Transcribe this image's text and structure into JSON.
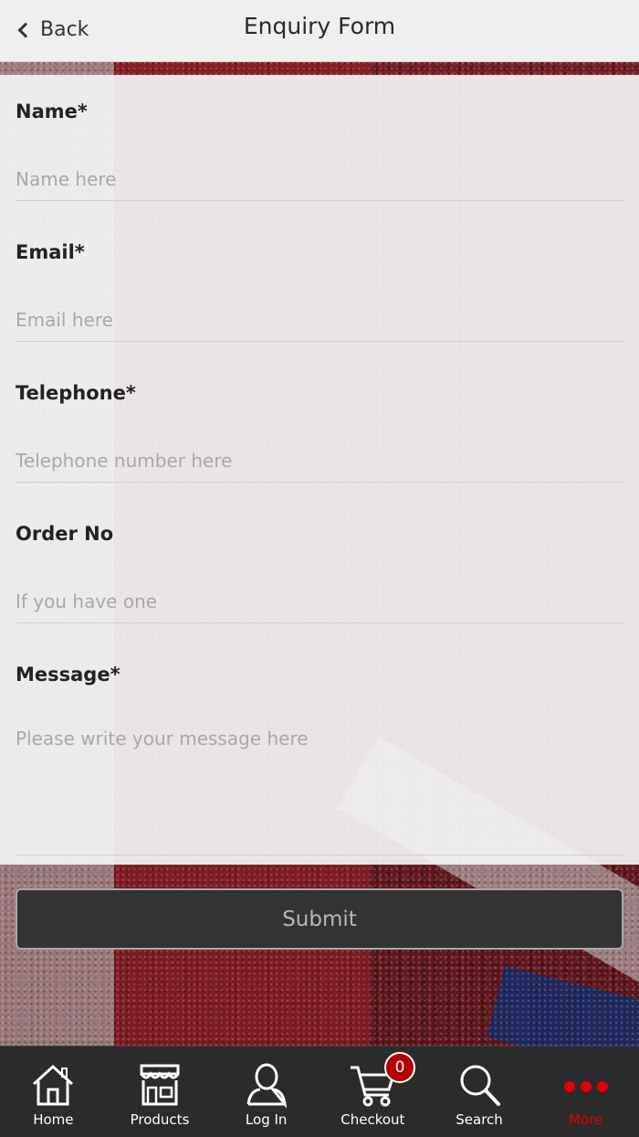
{
  "header": {
    "back_label": "Back",
    "title": "Enquiry Form"
  },
  "form": {
    "fields": [
      {
        "label": "Name*",
        "placeholder": "Name here"
      },
      {
        "label": "Email*",
        "placeholder": "Email here"
      },
      {
        "label": "Telephone*",
        "placeholder": "Telephone number here"
      },
      {
        "label": "Order No",
        "placeholder": "If you have one"
      },
      {
        "label": "Message*",
        "placeholder": "Please write your message here"
      }
    ],
    "submit_label": "Submit"
  },
  "nav": {
    "items": [
      {
        "label": "Home",
        "icon": "home-icon"
      },
      {
        "label": "Products",
        "icon": "store-icon"
      },
      {
        "label": "Log In",
        "icon": "user-icon"
      },
      {
        "label": "Checkout",
        "icon": "cart-icon",
        "badge": "0"
      },
      {
        "label": "Search",
        "icon": "search-icon"
      },
      {
        "label": "More",
        "icon": "more-dots-icon",
        "active": true
      }
    ],
    "active_color": "#e00000",
    "badge_color": "#b20000"
  }
}
